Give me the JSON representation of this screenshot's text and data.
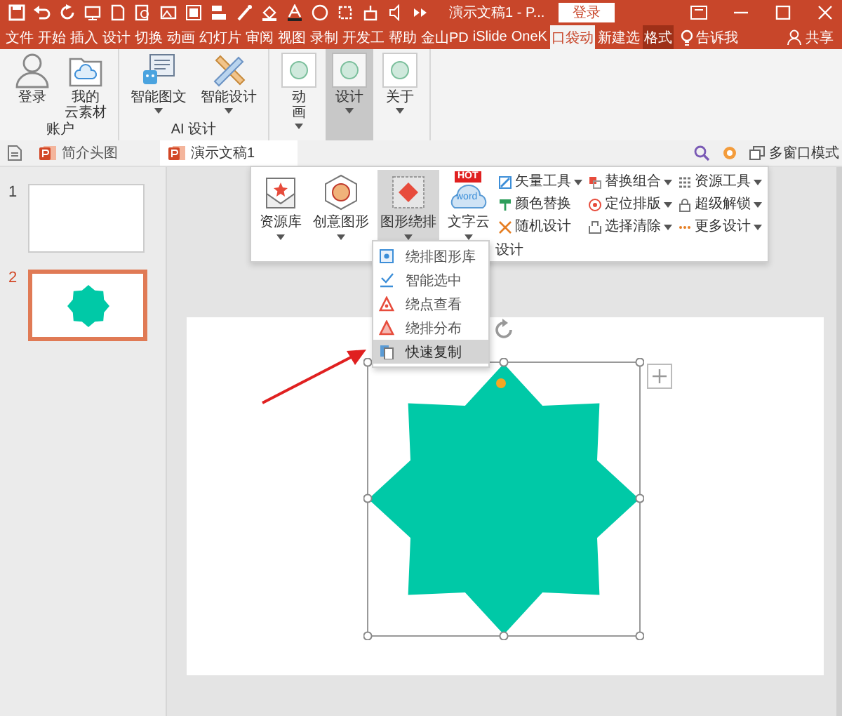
{
  "title_bar": {
    "title": "演示文稿1 - P...",
    "login_button": "登录"
  },
  "tabs": [
    {
      "label": "文件",
      "selected": false,
      "contextual": false
    },
    {
      "label": "开始",
      "selected": false,
      "contextual": false
    },
    {
      "label": "插入",
      "selected": false,
      "contextual": false
    },
    {
      "label": "设计",
      "selected": false,
      "contextual": false
    },
    {
      "label": "切换",
      "selected": false,
      "contextual": false
    },
    {
      "label": "动画",
      "selected": false,
      "contextual": false
    },
    {
      "label": "幻灯片",
      "selected": false,
      "contextual": false
    },
    {
      "label": "审阅",
      "selected": false,
      "contextual": false
    },
    {
      "label": "视图",
      "selected": false,
      "contextual": false
    },
    {
      "label": "录制",
      "selected": false,
      "contextual": false
    },
    {
      "label": "开发工",
      "selected": false,
      "contextual": false
    },
    {
      "label": "帮助",
      "selected": false,
      "contextual": false
    },
    {
      "label": "金山PD",
      "selected": false,
      "contextual": false
    },
    {
      "label": "iSlide",
      "selected": false,
      "contextual": false
    },
    {
      "label": "OneK",
      "selected": false,
      "contextual": false
    },
    {
      "label": "口袋动",
      "selected": true,
      "contextual": false
    },
    {
      "label": "新建选",
      "selected": false,
      "contextual": false
    },
    {
      "label": "格式",
      "selected": false,
      "contextual": true
    }
  ],
  "tell_me": "告诉我",
  "share": "共享",
  "ribbon_groups": [
    {
      "label": "账户",
      "buttons": [
        {
          "label": "登录",
          "dropdown": false,
          "selected": false
        },
        {
          "lines": [
            "我的",
            "云素材"
          ],
          "dropdown": false,
          "selected": false
        }
      ]
    },
    {
      "label": "AI 设计",
      "buttons": [
        {
          "label": "智能图文",
          "dropdown": true,
          "selected": false
        },
        {
          "label": "智能设计",
          "dropdown": true,
          "selected": false
        }
      ]
    },
    {
      "buttons": [
        {
          "lines": [
            "动",
            "画"
          ],
          "dropdown": true,
          "selected": false
        },
        {
          "label": "设计",
          "dropdown": true,
          "selected": true
        },
        {
          "label": "关于",
          "dropdown": true,
          "selected": false
        }
      ]
    }
  ],
  "document_tabs": [
    {
      "label": "简介头图",
      "selected": false
    },
    {
      "label": "演示文稿1",
      "selected": true
    }
  ],
  "window_mode_button": "多窗口模式",
  "design_panel": {
    "large_buttons": [
      {
        "label": "资源库",
        "dropdown": true,
        "selected": false
      },
      {
        "label": "创意图形",
        "dropdown": true,
        "selected": false
      },
      {
        "label": "图形绕排",
        "dropdown": true,
        "selected": true
      },
      {
        "label": "文字云",
        "dropdown": true,
        "selected": false,
        "badge": "HOT",
        "icon_text": "word"
      }
    ],
    "tool_columns": [
      [
        {
          "label": "矢量工具",
          "dropdown": true
        },
        {
          "label": "颜色替换",
          "dropdown": false
        },
        {
          "label": "随机设计",
          "dropdown": false
        }
      ],
      [
        {
          "label": "替换组合",
          "dropdown": true
        },
        {
          "label": "定位排版",
          "dropdown": true
        },
        {
          "label": "选择清除",
          "dropdown": true
        }
      ],
      [
        {
          "label": "资源工具",
          "dropdown": true
        },
        {
          "label": "超级解锁",
          "dropdown": true
        },
        {
          "label": "更多设计",
          "dropdown": true
        }
      ]
    ],
    "group_label": "设计"
  },
  "wrap_menu": [
    {
      "label": "绕排图形库",
      "selected": false
    },
    {
      "label": "智能选中",
      "selected": false
    },
    {
      "label": "绕点查看",
      "selected": false
    },
    {
      "label": "绕排分布",
      "selected": false
    },
    {
      "label": "快速复制",
      "selected": true
    }
  ],
  "slides": [
    {
      "number": "1",
      "selected": false,
      "kind": "blank"
    },
    {
      "number": "2",
      "selected": true,
      "kind": "shape"
    }
  ]
}
